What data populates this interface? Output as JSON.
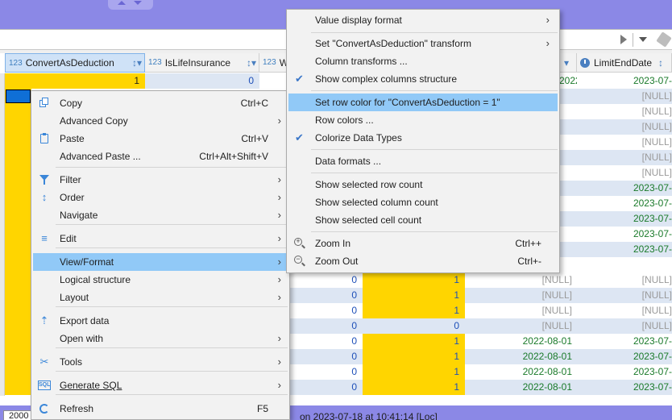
{
  "colors": {
    "band": "#8b88e6",
    "highlight_yellow": "#ffd500",
    "menu_hover": "#91c9f7",
    "date_green": "#1a7a2a",
    "null_gray": "#9a9a9a",
    "icon_blue": "#3a86d8"
  },
  "grid": {
    "columns": [
      {
        "type_label": "123",
        "label": "ConvertAsDeduction",
        "icon": "sort-icon"
      },
      {
        "type_label": "123",
        "label": "IsLifeInsurance",
        "icon": "sort-icon"
      },
      {
        "type_label": "123",
        "label": "W",
        "icon": "sort-icon"
      },
      {
        "type_label": "",
        "label": "LimitEndDate",
        "icon": "clock-icon"
      }
    ],
    "first_row": {
      "convert": "1",
      "islife": "0",
      "limit_end": "2023-07-"
    },
    "right_rows": [
      {
        "date": "2022-08-01",
        "limit": "2023-07-",
        "limit_null": false
      },
      {
        "date": "",
        "limit": "[NULL]",
        "limit_null": true
      },
      {
        "date": "",
        "limit": "[NULL]",
        "limit_null": true
      },
      {
        "date": "",
        "limit": "[NULL]",
        "limit_null": true
      },
      {
        "date": "",
        "limit": "[NULL]",
        "limit_null": true
      },
      {
        "date": "",
        "limit": "[NULL]",
        "limit_null": true
      },
      {
        "date": "",
        "limit": "[NULL]",
        "limit_null": true
      },
      {
        "date": "",
        "limit": "2023-07-",
        "limit_null": false
      },
      {
        "date": "",
        "limit": "2023-07-",
        "limit_null": false
      },
      {
        "date": "",
        "limit": "2023-07-",
        "limit_null": false
      },
      {
        "date": "",
        "limit": "2023-07-",
        "limit_null": false
      },
      {
        "date": "",
        "limit": "2023-07-",
        "limit_null": false
      }
    ],
    "lower_rows": [
      {
        "ins": "0",
        "w": "1",
        "date": "[NULL]",
        "date_null": true,
        "limit": "[NULL]",
        "limit_null": true
      },
      {
        "ins": "0",
        "w": "1",
        "date": "[NULL]",
        "date_null": true,
        "limit": "[NULL]",
        "limit_null": true
      },
      {
        "ins": "0",
        "w": "1",
        "date": "[NULL]",
        "date_null": true,
        "limit": "[NULL]",
        "limit_null": true
      },
      {
        "ins": "0",
        "w": "0",
        "date": "[NULL]",
        "date_null": true,
        "limit": "[NULL]",
        "limit_null": true
      },
      {
        "ins": "0",
        "w": "1",
        "date": "2022-08-01",
        "date_null": false,
        "limit": "2023-07-",
        "limit_null": false
      },
      {
        "ins": "0",
        "w": "1",
        "date": "2022-08-01",
        "date_null": false,
        "limit": "2023-07-",
        "limit_null": false
      },
      {
        "ins": "0",
        "w": "1",
        "date": "2022-08-01",
        "date_null": false,
        "limit": "2023-07-",
        "limit_null": false
      },
      {
        "ins": "0",
        "w": "1",
        "date": "2022-08-01",
        "date_null": false,
        "limit": "2023-07-",
        "limit_null": false
      }
    ]
  },
  "status": {
    "box_value": "2000",
    "text": "on 2023-07-18 at 10:41:14 [Loc]"
  },
  "context_menu": [
    {
      "label": "Copy",
      "shortcut": "Ctrl+C",
      "icon": "copy-icon",
      "arrow": false
    },
    {
      "label": "Advanced Copy",
      "shortcut": "",
      "icon": "",
      "arrow": true
    },
    {
      "label": "Paste",
      "shortcut": "Ctrl+V",
      "icon": "paste-icon",
      "arrow": false
    },
    {
      "label": "Advanced Paste ...",
      "shortcut": "Ctrl+Alt+Shift+V",
      "icon": "",
      "arrow": false
    },
    {
      "label": "Filter",
      "shortcut": "",
      "icon": "filter-icon",
      "arrow": true
    },
    {
      "label": "Order",
      "shortcut": "",
      "icon": "order-icon",
      "arrow": true
    },
    {
      "label": "Navigate",
      "shortcut": "",
      "icon": "",
      "arrow": true
    },
    {
      "label": "Edit",
      "shortcut": "",
      "icon": "edit-icon",
      "arrow": true
    },
    {
      "label": "View/Format",
      "shortcut": "",
      "icon": "",
      "arrow": true
    },
    {
      "label": "Logical structure",
      "shortcut": "",
      "icon": "",
      "arrow": true
    },
    {
      "label": "Layout",
      "shortcut": "",
      "icon": "",
      "arrow": true
    },
    {
      "label": "Export data",
      "shortcut": "",
      "icon": "export-icon",
      "arrow": false
    },
    {
      "label": "Open with",
      "shortcut": "",
      "icon": "",
      "arrow": true
    },
    {
      "label": "Tools",
      "shortcut": "",
      "icon": "tools-icon",
      "arrow": true
    },
    {
      "label": "Generate SQL",
      "shortcut": "",
      "icon": "sql-icon",
      "arrow": true
    },
    {
      "label": "Refresh",
      "shortcut": "F5",
      "icon": "refresh-icon",
      "arrow": false
    }
  ],
  "submenu": [
    {
      "label": "Value display format",
      "shortcut": "",
      "arrow": true,
      "checked": false,
      "icon": ""
    },
    {
      "label": "Set \"ConvertAsDeduction\" transform",
      "shortcut": "",
      "arrow": true,
      "checked": false,
      "icon": ""
    },
    {
      "label": "Column transforms ...",
      "shortcut": "",
      "arrow": false,
      "checked": false,
      "icon": ""
    },
    {
      "label": "Show complex columns structure",
      "shortcut": "",
      "arrow": false,
      "checked": true,
      "icon": ""
    },
    {
      "label": "Set row color for \"ConvertAsDeduction = 1\"",
      "shortcut": "",
      "arrow": false,
      "checked": false,
      "icon": ""
    },
    {
      "label": "Row colors ...",
      "shortcut": "",
      "arrow": false,
      "checked": false,
      "icon": ""
    },
    {
      "label": "Colorize Data Types",
      "shortcut": "",
      "arrow": false,
      "checked": true,
      "icon": ""
    },
    {
      "label": "Data formats ...",
      "shortcut": "",
      "arrow": false,
      "checked": false,
      "icon": ""
    },
    {
      "label": "Show selected row count",
      "shortcut": "",
      "arrow": false,
      "checked": false,
      "icon": ""
    },
    {
      "label": "Show selected column count",
      "shortcut": "",
      "arrow": false,
      "checked": false,
      "icon": ""
    },
    {
      "label": "Show selected cell count",
      "shortcut": "",
      "arrow": false,
      "checked": false,
      "icon": ""
    },
    {
      "label": "Zoom In",
      "shortcut": "Ctrl++",
      "arrow": false,
      "checked": false,
      "icon": "zoom-in-icon"
    },
    {
      "label": "Zoom Out",
      "shortcut": "Ctrl+-",
      "arrow": false,
      "checked": false,
      "icon": "zoom-out-icon"
    }
  ]
}
